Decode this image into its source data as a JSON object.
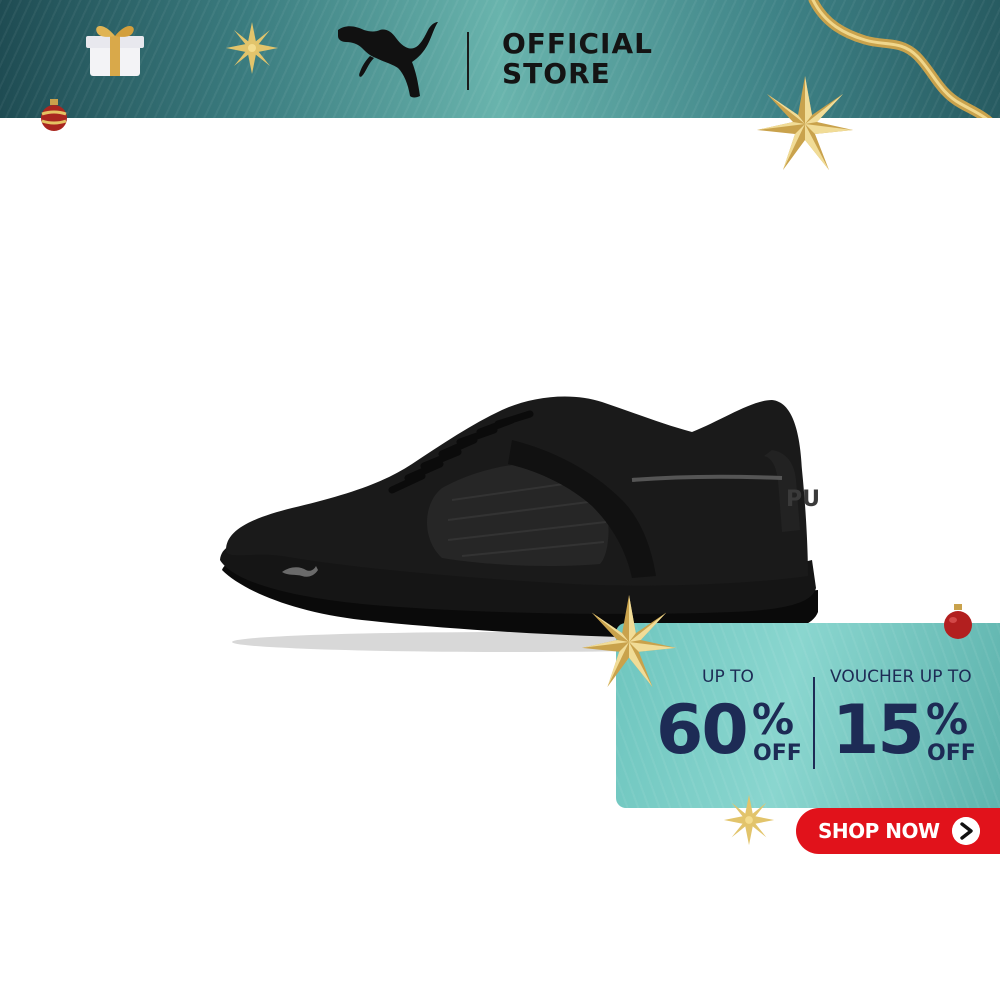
{
  "banner": {
    "store_line1": "OFFICIAL",
    "store_line2": "STORE",
    "logo_icon": "puma-cat-icon",
    "decor_icons": [
      "gift-box-icon",
      "snowflake-icon",
      "ornament-icon",
      "ribbon-icon",
      "star-icon"
    ]
  },
  "product": {
    "image_icon": "sneaker-image"
  },
  "promo": {
    "deal_a": {
      "label": "UP TO",
      "number": "60",
      "percent": "%",
      "off": "OFF"
    },
    "deal_b": {
      "label": "VOUCHER UP TO",
      "number": "15",
      "percent": "%",
      "off": "OFF"
    },
    "cta_label": "SHOP NOW",
    "cta_icon": "chevron-right-icon"
  },
  "colors": {
    "banner_teal": "#3b7d80",
    "promo_teal": "#7fcfc8",
    "navy_text": "#1d2b55",
    "cta_red": "#e1121b",
    "gold": "#d9b85c"
  }
}
